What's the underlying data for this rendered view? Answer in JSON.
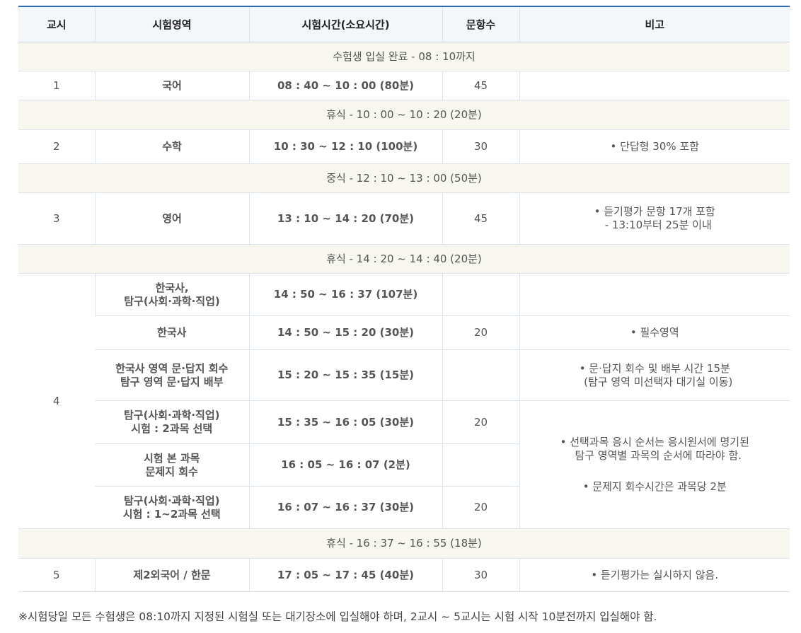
{
  "headers": [
    "교시",
    "시험영역",
    "시험시간(소요시간)",
    "문항수",
    "비고"
  ],
  "band_entry": "수험생 입실 완료 - 08 : 10까지",
  "p1": {
    "period": "1",
    "subject": "국어",
    "time": "08 : 40 ~ 10 : 00 (80분)",
    "count": "45",
    "note": ""
  },
  "band_break1": "휴식 - 10 : 00 ~ 10 : 20 (20분)",
  "p2": {
    "period": "2",
    "subject": "수학",
    "time": "10 : 30 ~ 12 : 10 (100분)",
    "count": "30",
    "note": "• 단답형 30% 포함"
  },
  "band_lunch": "중식 - 12 : 10 ~ 13 : 00 (50분)",
  "p3": {
    "period": "3",
    "subject": "영어",
    "time": "13 : 10 ~ 14 : 20 (70분)",
    "count": "45",
    "note1": "• 듣기평가 문항 17개 포함",
    "note2": "- 13:10부터 25분 이내"
  },
  "band_break2": "휴식 - 14 : 20 ~ 14 : 40 (20분)",
  "p4": {
    "period": "4",
    "r1": {
      "subject1": "한국사,",
      "subject2": "탐구(사회·과학·직업)",
      "time": "14 : 50 ~ 16 : 37 (107분)"
    },
    "r2": {
      "subject": "한국사",
      "time": "14 : 50 ~ 15 : 20 (30분)",
      "count": "20",
      "note": "• 필수영역"
    },
    "r3": {
      "subject1": "한국사 영역 문·답지 회수",
      "subject2": "탐구 영역 문·답지 배부",
      "time": "15 : 20 ~ 15 : 35 (15분)",
      "note1": "• 문·답지 회수 및 배부 시간 15분",
      "note2": "(탐구 영역 미선택자 대기실 이동)"
    },
    "r4": {
      "subject1": "탐구(사회·과학·직업)",
      "subject2": "시험 : 2과목 선택",
      "time": "15 : 35 ~ 16 : 05 (30분)",
      "count": "20",
      "note1": "• 선택과목 응시 순서는 응시원서에 명기된",
      "note2": "탐구 영역별 과목의 순서에 따라야 함.",
      "note3": "• 문제지 회수시간은 과목당 2분"
    },
    "r5": {
      "subject1": "시험 본 과목",
      "subject2": "문제지 회수",
      "time": "16 : 05 ~ 16 : 07 (2분)"
    },
    "r6": {
      "subject1": "탐구(사회·과학·직업)",
      "subject2": "시험 : 1~2과목 선택",
      "time": "16 : 07 ~ 16 : 37 (30분)",
      "count": "20"
    }
  },
  "band_break3": "휴식 - 16 : 37 ~ 16 : 55 (18분)",
  "p5": {
    "period": "5",
    "subject": "제2외국어 / 한문",
    "time": "17 : 05 ~ 17 : 45 (40분)",
    "count": "30",
    "note": "• 듣기평가는 실시하지 않음."
  },
  "footer": "※시험당일 모든 수험생은 08:10까지 지정된 시험실 또는 대기장소에 입실해야 하며, 2교시 ~ 5교시는 시험 시작 10분전까지 입실해야 함."
}
